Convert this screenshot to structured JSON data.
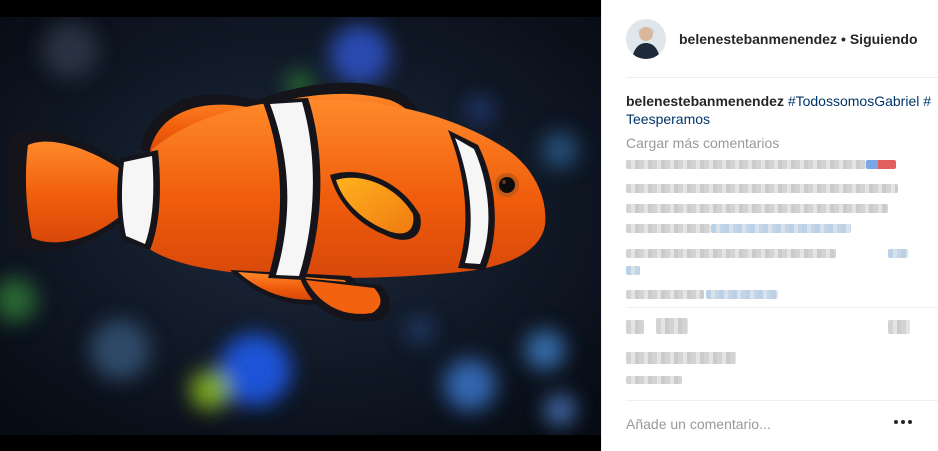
{
  "post": {
    "username": "belenestebanmenendez",
    "separator": "•",
    "follow_status": "Siguiendo",
    "caption": {
      "username": "belenestebanmenendez",
      "hashtags": [
        "#TodossomosGabriel",
        "#Teesperamos"
      ]
    },
    "load_more_comments": "Cargar más comentarios",
    "comment_placeholder": "Añade un comentario...",
    "image_subject": "clownfish"
  },
  "colors": {
    "accent_link": "#003569",
    "text": "#262626",
    "muted": "#999999",
    "fish_orange": "#f26a10",
    "background_dark": "#0c1420"
  },
  "icons": [
    "more-options-icon"
  ]
}
